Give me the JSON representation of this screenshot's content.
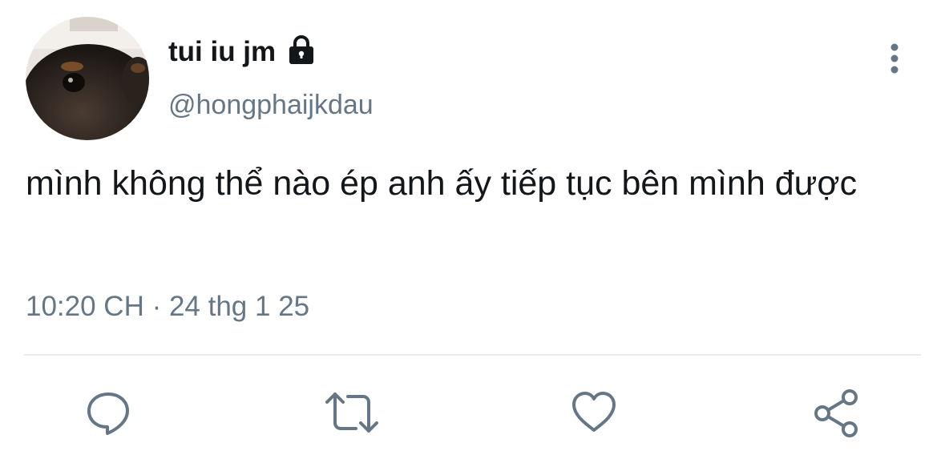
{
  "user": {
    "display_name": "tui iu jm",
    "handle": "@hongphaijkdau"
  },
  "tweet": {
    "text": "mình không thể nào ép anh ấy tiếp tục bên mình được",
    "timestamp": "10:20 CH · 24 thg 1 25"
  },
  "icons": {
    "lock": "lock-icon",
    "more": "more-vertical-icon",
    "reply": "reply-icon",
    "retweet": "retweet-icon",
    "like": "heart-icon",
    "share": "share-icon"
  },
  "colors": {
    "text_primary": "#14171a",
    "text_secondary": "#657786",
    "divider": "#e6ecf0"
  }
}
